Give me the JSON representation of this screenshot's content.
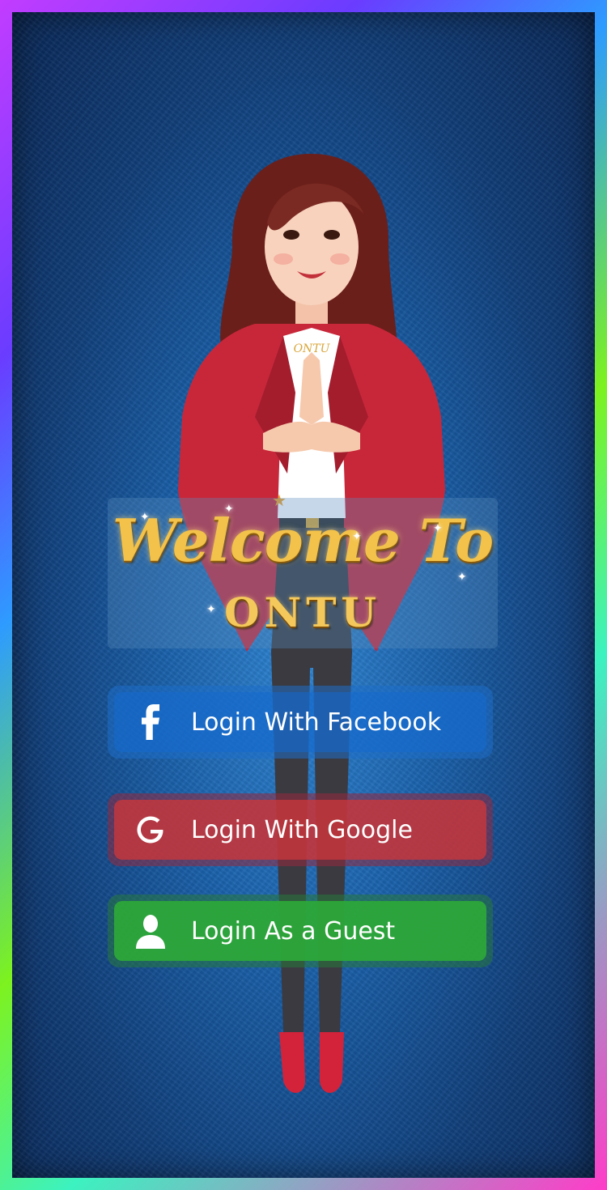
{
  "welcome": {
    "line1": "Welcome To",
    "line2": "ONTU"
  },
  "character": {
    "necklace_text": "ONTU"
  },
  "buttons": {
    "facebook": {
      "label": "Login With Facebook",
      "icon": "facebook-icon"
    },
    "google": {
      "label": "Login With Google",
      "icon": "google-icon"
    },
    "guest": {
      "label": "Login As a Guest",
      "icon": "user-icon"
    }
  },
  "colors": {
    "facebook": "#1469cd",
    "google": "#c8373c",
    "guest": "#2daa37",
    "title_gold": "#f2c24a",
    "background": "#1a5fa8"
  }
}
